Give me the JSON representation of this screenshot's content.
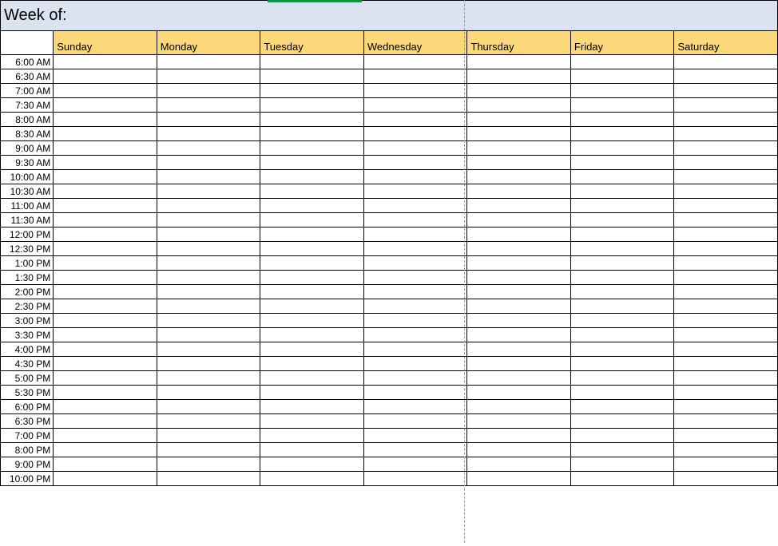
{
  "title": "Week of:",
  "days": [
    "Sunday",
    "Monday",
    "Tuesday",
    "Wednesday",
    "Thursday",
    "Friday",
    "Saturday"
  ],
  "times": [
    "6:00 AM",
    "6:30 AM",
    "7:00 AM",
    "7:30 AM",
    "8:00 AM",
    "8:30 AM",
    "9:00 AM",
    "9:30 AM",
    "10:00 AM",
    "10:30 AM",
    "11:00 AM",
    "11:30 AM",
    "12:00 PM",
    "12:30 PM",
    "1:00 PM",
    "1:30 PM",
    "2:00 PM",
    "2:30 PM",
    "3:00 PM",
    "3:30 PM",
    "4:00 PM",
    "4:30 PM",
    "5:00 PM",
    "5:30 PM",
    "6:00 PM",
    "6:30 PM",
    "7:00 PM",
    "8:00 PM",
    "9:00 PM",
    "10:00 PM"
  ],
  "cells": {}
}
